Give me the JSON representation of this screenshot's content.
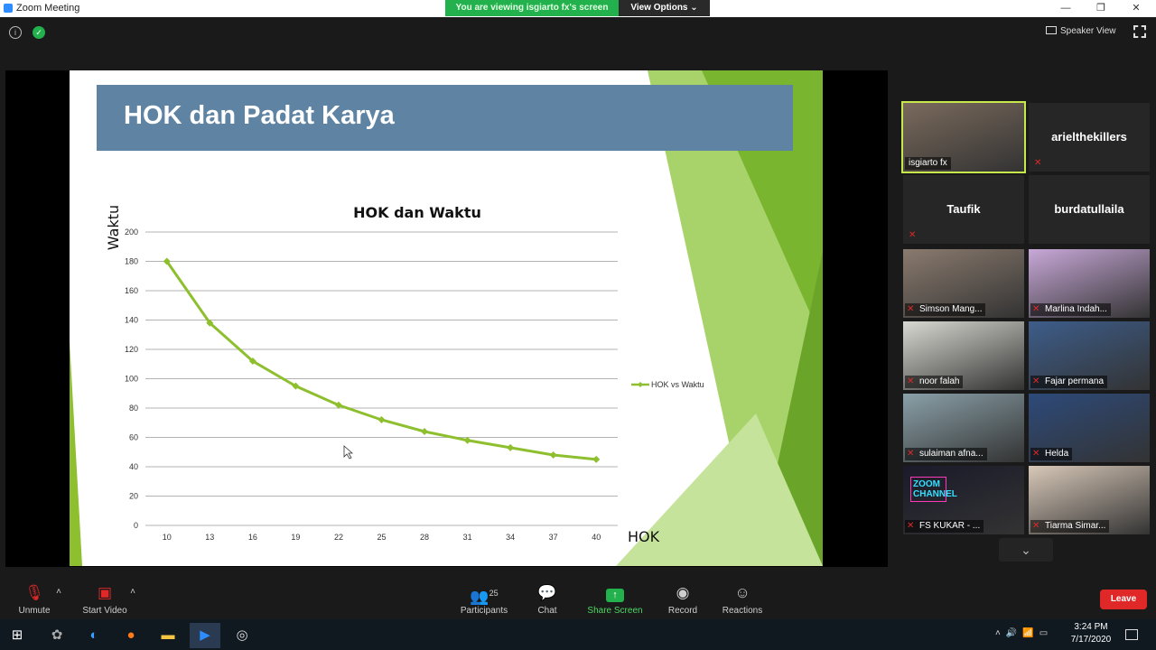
{
  "window": {
    "title": "Zoom Meeting",
    "banner": "You are viewing isgiarto fx's screen",
    "view_options": "View Options ⌄",
    "minimize": "—",
    "restore": "❐",
    "close": "✕"
  },
  "topbar": {
    "speaker_view": "Speaker View"
  },
  "slide": {
    "title": "HOK dan Padat Karya"
  },
  "chart_data": {
    "type": "line",
    "title": "HOK dan Waktu",
    "xlabel": "HOK",
    "ylabel": "Waktu",
    "categories": [
      "10",
      "13",
      "16",
      "19",
      "22",
      "25",
      "28",
      "31",
      "34",
      "37",
      "40"
    ],
    "series": [
      {
        "name": "HOK vs Waktu",
        "values": [
          180,
          138,
          112,
          95,
          82,
          72,
          64,
          58,
          53,
          48,
          45
        ],
        "color": "#8dbf2e"
      }
    ],
    "yticks": [
      "0",
      "20",
      "40",
      "60",
      "80",
      "100",
      "120",
      "140",
      "160",
      "180",
      "200"
    ],
    "ylim": [
      0,
      200
    ],
    "grid": true,
    "legend": "right"
  },
  "gallery": {
    "participants": [
      {
        "name": "isgiarto fx",
        "video": true,
        "active": true
      },
      {
        "name": "arielthekillers",
        "video": false,
        "muted": true
      },
      {
        "name": "Taufik",
        "video": false,
        "muted": true
      },
      {
        "name": "burdatullaila",
        "video": false,
        "muted": false
      },
      {
        "name": "Simson Mang...",
        "video": true,
        "muted": true
      },
      {
        "name": "Marlina Indah...",
        "video": true,
        "muted": true
      },
      {
        "name": "noor falah",
        "video": true,
        "muted": true
      },
      {
        "name": "Fajar permana",
        "video": true,
        "muted": true
      },
      {
        "name": "sulaiman afna...",
        "video": true,
        "muted": true
      },
      {
        "name": "Helda",
        "video": true,
        "muted": true
      },
      {
        "name": "FS KUKAR - ...",
        "video": true,
        "muted": true
      },
      {
        "name": "Tiarma Simar...",
        "video": true,
        "muted": true
      }
    ],
    "zoom_channel_text": "ZOOM CHANNEL",
    "expand_icon": "⌄"
  },
  "toolbar": {
    "unmute": "Unmute",
    "start_video": "Start Video",
    "participants": "Participants",
    "participants_count": "25",
    "chat": "Chat",
    "share_screen": "Share Screen",
    "record": "Record",
    "reactions": "Reactions",
    "leave": "Leave",
    "caret": "˄"
  },
  "taskbar": {
    "time": "3:24 PM",
    "date": "7/17/2020"
  },
  "colors": {
    "accent_green": "#22b14c",
    "leave_red": "#e02828",
    "slide_header": "#5e83a3",
    "chart_line": "#8dbf2e"
  }
}
